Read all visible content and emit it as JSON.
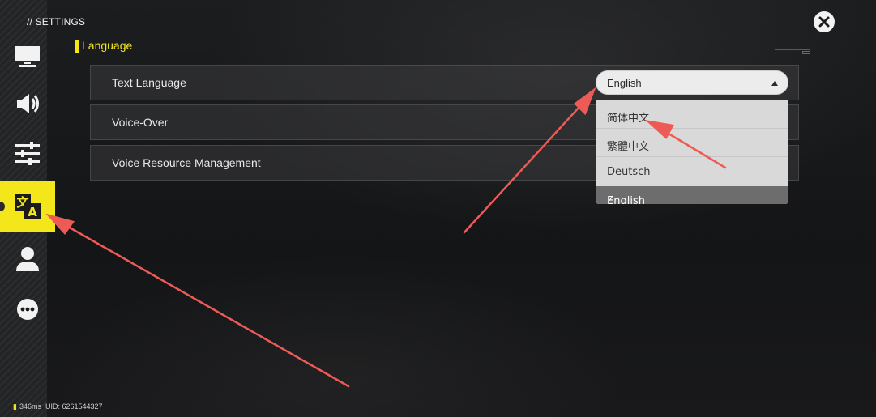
{
  "header": {
    "title": "// SETTINGS",
    "close_icon": "close-x-icon"
  },
  "sidebar": {
    "items": [
      {
        "key": "display",
        "icon": "monitor-icon",
        "active": false
      },
      {
        "key": "audio",
        "icon": "speaker-icon",
        "active": false
      },
      {
        "key": "controls",
        "icon": "sliders-icon",
        "active": false
      },
      {
        "key": "language",
        "icon": "translate-icon",
        "active": true
      },
      {
        "key": "account",
        "icon": "person-icon",
        "active": false
      },
      {
        "key": "more",
        "icon": "ellipsis-icon",
        "active": false
      }
    ]
  },
  "section": {
    "title": "Language"
  },
  "rows": [
    {
      "label": "Text Language"
    },
    {
      "label": "Voice-Over"
    },
    {
      "label": "Voice Resource Management"
    }
  ],
  "text_language_select": {
    "value": "English",
    "options": [
      "简体中文",
      "繁體中文",
      "Deutsch",
      "English"
    ],
    "selected_index": 3
  },
  "status_bar": {
    "ping": "346ms",
    "uid": "UID: 6261544327"
  },
  "colors": {
    "accent": "#f3e61b",
    "annotation_arrow": "#ee5a55"
  }
}
